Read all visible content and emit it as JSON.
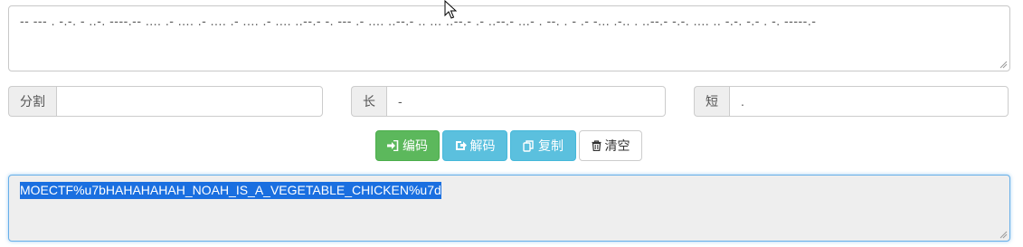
{
  "input": {
    "morse_text": "-- --- . -.-. - ..-. ----.-- .... .- .... .- .... .- .... .- .... ..--.- -. --- .- .... ..--.- .. ... ..--.- .- ..--.- ...- . --. . - .- -... .-.. . ..--.- -.-. .... .. -.-. -.- . -. -----.-"
  },
  "split": {
    "label": "分割",
    "value": ""
  },
  "long": {
    "label": "长",
    "value": "-"
  },
  "short": {
    "label": "短",
    "value": "."
  },
  "buttons": {
    "encode": "编码",
    "decode": "解码",
    "copy": "复制",
    "clear": "清空"
  },
  "output": {
    "text": "MOECTF%u7bHAHAHAHAH_NOAH_IS_A_VEGETABLE_CHICKEN%u7d"
  },
  "colors": {
    "success": "#5cb85c",
    "info": "#5bc0de",
    "selection": "#1a6fe0"
  },
  "icons": {
    "encode": "sign-in-icon",
    "decode": "share-icon",
    "copy": "copy-icon",
    "clear": "trash-icon"
  }
}
